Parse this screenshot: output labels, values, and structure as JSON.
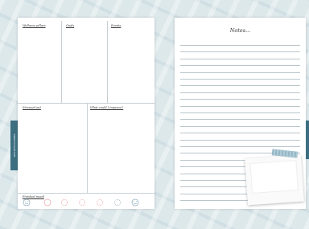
{
  "left_page": {
    "sections": {
      "top_left": "Wellness pillars",
      "top_middle": "Goals",
      "top_right": "Events",
      "middle_left": "Stressed out",
      "middle_right": "What could I improve?",
      "bottom": "Finished mood"
    },
    "mood_icons": [
      "sad-face-icon",
      "circle-icon",
      "sunburst-icon",
      "sunburst-icon",
      "sunburst-icon",
      "sunburst-icon",
      "happy-face-icon"
    ]
  },
  "left_tab": {
    "label": "WELLNESS PLANNER"
  },
  "right_page": {
    "title": "Notes..."
  },
  "colors": {
    "tab": "#3d6f81",
    "background": "#dde8eb",
    "mood_sun": "#e9a1a9",
    "mood_neutral": "#8aa8b8"
  }
}
